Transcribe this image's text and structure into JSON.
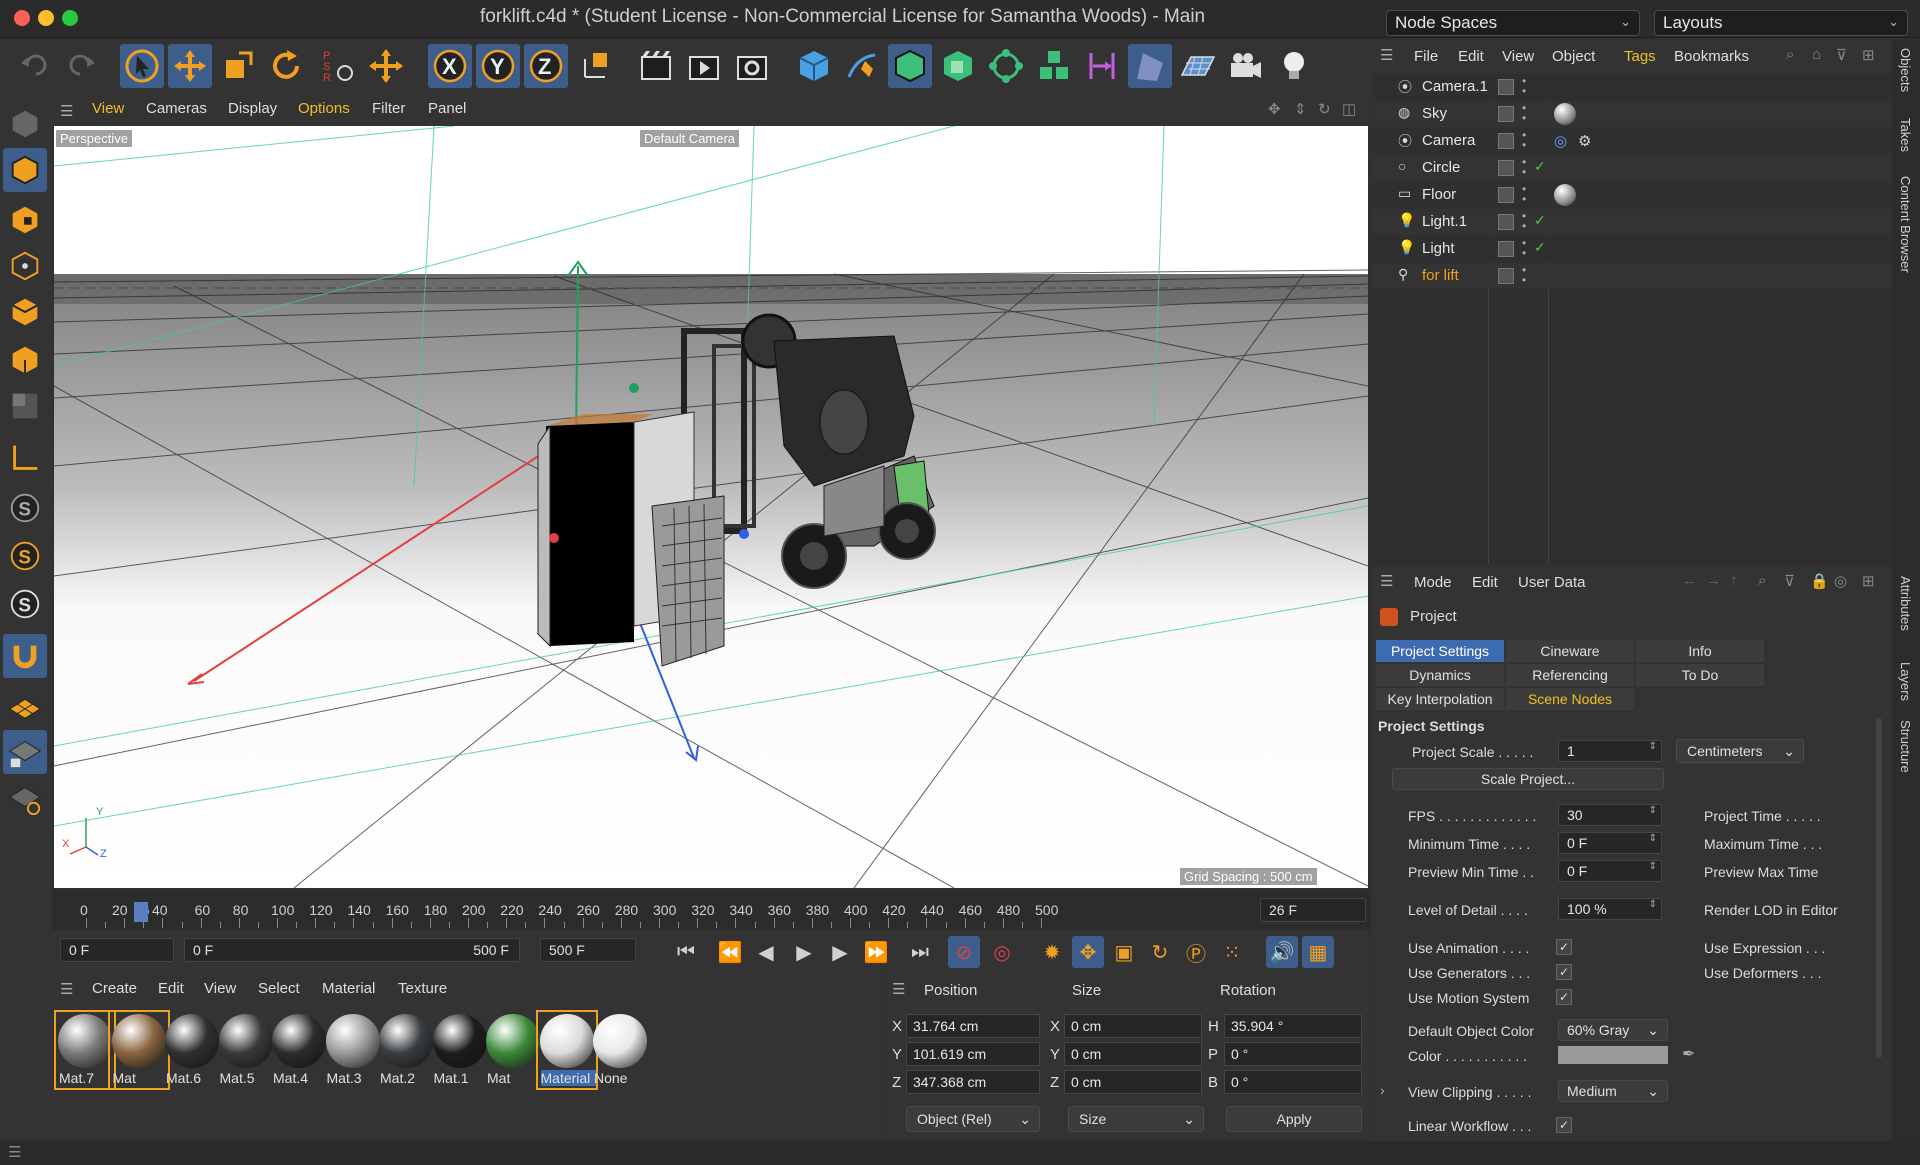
{
  "window": {
    "title": "forklift.c4d * (Student License - Non-Commercial License for Samantha Woods) - Main",
    "node_spaces": "Node Spaces",
    "layouts": "Layouts"
  },
  "viewport": {
    "menu": [
      "View",
      "Cameras",
      "Display",
      "Options",
      "Filter",
      "Panel"
    ],
    "projection": "Perspective",
    "camera": "Default Camera",
    "grid_spacing": "Grid Spacing : 500 cm",
    "axes": {
      "x": "X",
      "y": "Y",
      "z": "Z"
    }
  },
  "timeline": {
    "ticks": [
      "0",
      "20",
      "26",
      "40",
      "60",
      "80",
      "100",
      "120",
      "140",
      "160",
      "180",
      "200",
      "220",
      "240",
      "260",
      "280",
      "300",
      "320",
      "340",
      "360",
      "380",
      "400",
      "420",
      "440",
      "460",
      "480",
      "500"
    ],
    "current_frame": "26 F",
    "start": "0 F",
    "range_start": "0 F",
    "range_end": "500 F",
    "end": "500 F"
  },
  "materials": {
    "menu": [
      "Create",
      "Edit",
      "View",
      "Select",
      "Material",
      "Texture"
    ],
    "items": [
      {
        "name": "Mat.7",
        "color": "#7a7a7a"
      },
      {
        "name": "Mat",
        "color": "#8a6440"
      },
      {
        "name": "Mat.6",
        "color": "#303030"
      },
      {
        "name": "Mat.5",
        "color": "#3a3a3a"
      },
      {
        "name": "Mat.4",
        "color": "#2c2c2c"
      },
      {
        "name": "Mat.3",
        "color": "#9a9a9a"
      },
      {
        "name": "Mat.2",
        "color": "#3a3e40"
      },
      {
        "name": "Mat.1",
        "color": "#1c1c1c"
      },
      {
        "name": "Mat",
        "color": "#3c8a3a"
      },
      {
        "name": "Material",
        "color": "#dcdcdc"
      },
      {
        "name": "None",
        "color": "#e8e8e8"
      }
    ]
  },
  "coordinates": {
    "headers": {
      "position": "Position",
      "size": "Size",
      "rotation": "Rotation"
    },
    "axis_pos": [
      "X",
      "Y",
      "Z"
    ],
    "axis_rot": [
      "H",
      "P",
      "B"
    ],
    "position": [
      "31.764 cm",
      "101.619 cm",
      "347.368 cm"
    ],
    "size": [
      "0 cm",
      "0 cm",
      "0 cm"
    ],
    "rotation": [
      "35.904 °",
      "0 °",
      "0 °"
    ],
    "mode": "Object (Rel)",
    "size_mode": "Size",
    "apply": "Apply"
  },
  "objects": {
    "menu": [
      "File",
      "Edit",
      "View",
      "Object",
      "Tags",
      "Bookmarks"
    ],
    "items": [
      {
        "name": "Camera.1",
        "color": "#e6e6e6"
      },
      {
        "name": "Sky",
        "color": "#e6e6e6"
      },
      {
        "name": "Camera",
        "color": "#e6e6e6"
      },
      {
        "name": "Circle",
        "color": "#e6e6e6"
      },
      {
        "name": "Floor",
        "color": "#e6e6e6"
      },
      {
        "name": "Light.1",
        "color": "#e6e6e6"
      },
      {
        "name": "Light",
        "color": "#e6e6e6"
      },
      {
        "name": "for lift",
        "color": "#f0a020"
      }
    ]
  },
  "attributes": {
    "menu": [
      "Mode",
      "Edit",
      "User Data"
    ],
    "object": "Project",
    "tabs": [
      [
        "Project Settings",
        "Cineware",
        "Info"
      ],
      [
        "Dynamics",
        "Referencing",
        "To Do"
      ],
      [
        "Key Interpolation",
        "Scene Nodes"
      ]
    ],
    "section": "Project Settings",
    "project_scale_label": "Project Scale . . . . .",
    "project_scale": "1",
    "scale_unit": "Centimeters",
    "scale_button": "Scale Project...",
    "fps_label": "FPS . . . . . . . . . . . . .",
    "fps": "30",
    "project_time_label": "Project Time . . . . .",
    "min_time_label": "Minimum Time . . . .",
    "min_time": "0 F",
    "max_time_label": "Maximum Time . . .",
    "preview_min_label": "Preview Min Time . .",
    "preview_min": "0 F",
    "preview_max_label": "Preview Max Time",
    "lod_label": "Level of Detail . . . .",
    "lod": "100 %",
    "render_lod_label": "Render LOD in Editor",
    "use_animation": "Use Animation . . . .",
    "use_expression": "Use Expression . . .",
    "use_generators": "Use Generators . . .",
    "use_deformers": "Use Deformers . . .",
    "use_motion": "Use Motion System",
    "default_color_label": "Default Object Color",
    "default_color": "60% Gray",
    "color_label": "Color . . . . . . . . . . .",
    "view_clipping_label": "View Clipping . . . . .",
    "view_clipping": "Medium",
    "linear_label": "Linear Workflow . . ."
  },
  "side_tabs": [
    "Objects",
    "Takes",
    "Content Browser",
    "Attributes",
    "Layers",
    "Structure"
  ]
}
